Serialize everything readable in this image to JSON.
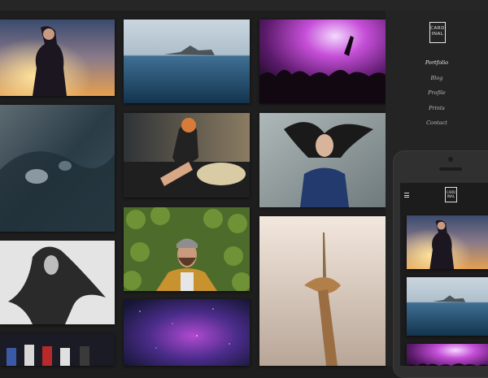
{
  "logo": {
    "line1": "CARD",
    "line2": "INAL"
  },
  "nav": [
    {
      "label": "Portfolio",
      "active": true
    },
    {
      "label": "Blog",
      "active": false
    },
    {
      "label": "Profile",
      "active": false
    },
    {
      "label": "Prints",
      "active": false
    },
    {
      "label": "Contact",
      "active": false
    }
  ],
  "mobile": {
    "logo_line1": "CARD",
    "logo_line2": "INAL",
    "menu_icon": "hamburger-icon"
  },
  "colors": {
    "background": "#1e1e1e",
    "panel": "#242424",
    "nav_text": "#bdbdbd",
    "accent": "#f0f0f0"
  }
}
